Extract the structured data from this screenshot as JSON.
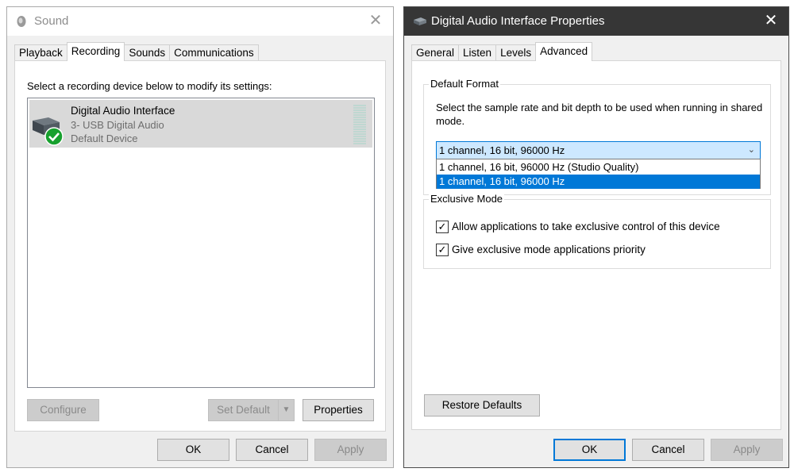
{
  "sound_window": {
    "title": "Sound",
    "tabs": [
      {
        "label": "Playback"
      },
      {
        "label": "Recording"
      },
      {
        "label": "Sounds"
      },
      {
        "label": "Communications"
      }
    ],
    "instruction": "Select a recording device below to modify its settings:",
    "device": {
      "name": "Digital Audio Interface",
      "subtitle": "3- USB Digital Audio",
      "status": "Default Device",
      "icon": "microphone-device-icon",
      "badge_icon": "checkmark-icon",
      "badge_color": "#17a02e"
    },
    "buttons": {
      "configure": "Configure",
      "set_default": "Set Default",
      "properties": "Properties",
      "ok": "OK",
      "cancel": "Cancel",
      "apply": "Apply"
    }
  },
  "properties_window": {
    "title": "Digital Audio Interface Properties",
    "tabs": [
      {
        "label": "General"
      },
      {
        "label": "Listen"
      },
      {
        "label": "Levels"
      },
      {
        "label": "Advanced"
      }
    ],
    "default_format": {
      "label": "Default Format",
      "description": "Select the sample rate and bit depth to be used when running in shared mode.",
      "selected": "1 channel, 16 bit, 96000 Hz",
      "options": [
        "1 channel, 16 bit, 96000 Hz (Studio Quality)",
        "1 channel, 16 bit, 96000 Hz"
      ]
    },
    "exclusive_mode": {
      "label": "Exclusive Mode",
      "allow_exclusive": {
        "label": "Allow applications to take exclusive control of this device",
        "checked": true
      },
      "give_priority": {
        "label": "Give exclusive mode applications priority",
        "checked": true
      }
    },
    "buttons": {
      "restore_defaults": "Restore Defaults",
      "ok": "OK",
      "cancel": "Cancel",
      "apply": "Apply"
    }
  },
  "colors": {
    "accent": "#0078d7",
    "dark_titlebar": "#363636"
  }
}
